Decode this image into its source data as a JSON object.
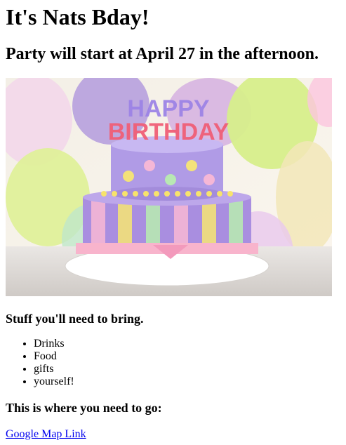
{
  "page": {
    "title": "It's Nats Bday!",
    "subtitle": "Party will start at April 27 in the afternoon.",
    "image": {
      "alt": "Birthday cake with Happy Birthday candles and balloons",
      "candle_text": "HAPPY BIRTHDAY"
    },
    "bring_heading": "Stuff you'll need to bring.",
    "bring_items": [
      "Drinks",
      "Food",
      "gifts",
      "yourself!"
    ],
    "go_heading": "This is where you need to go:",
    "map_link": "Google Map Link"
  }
}
